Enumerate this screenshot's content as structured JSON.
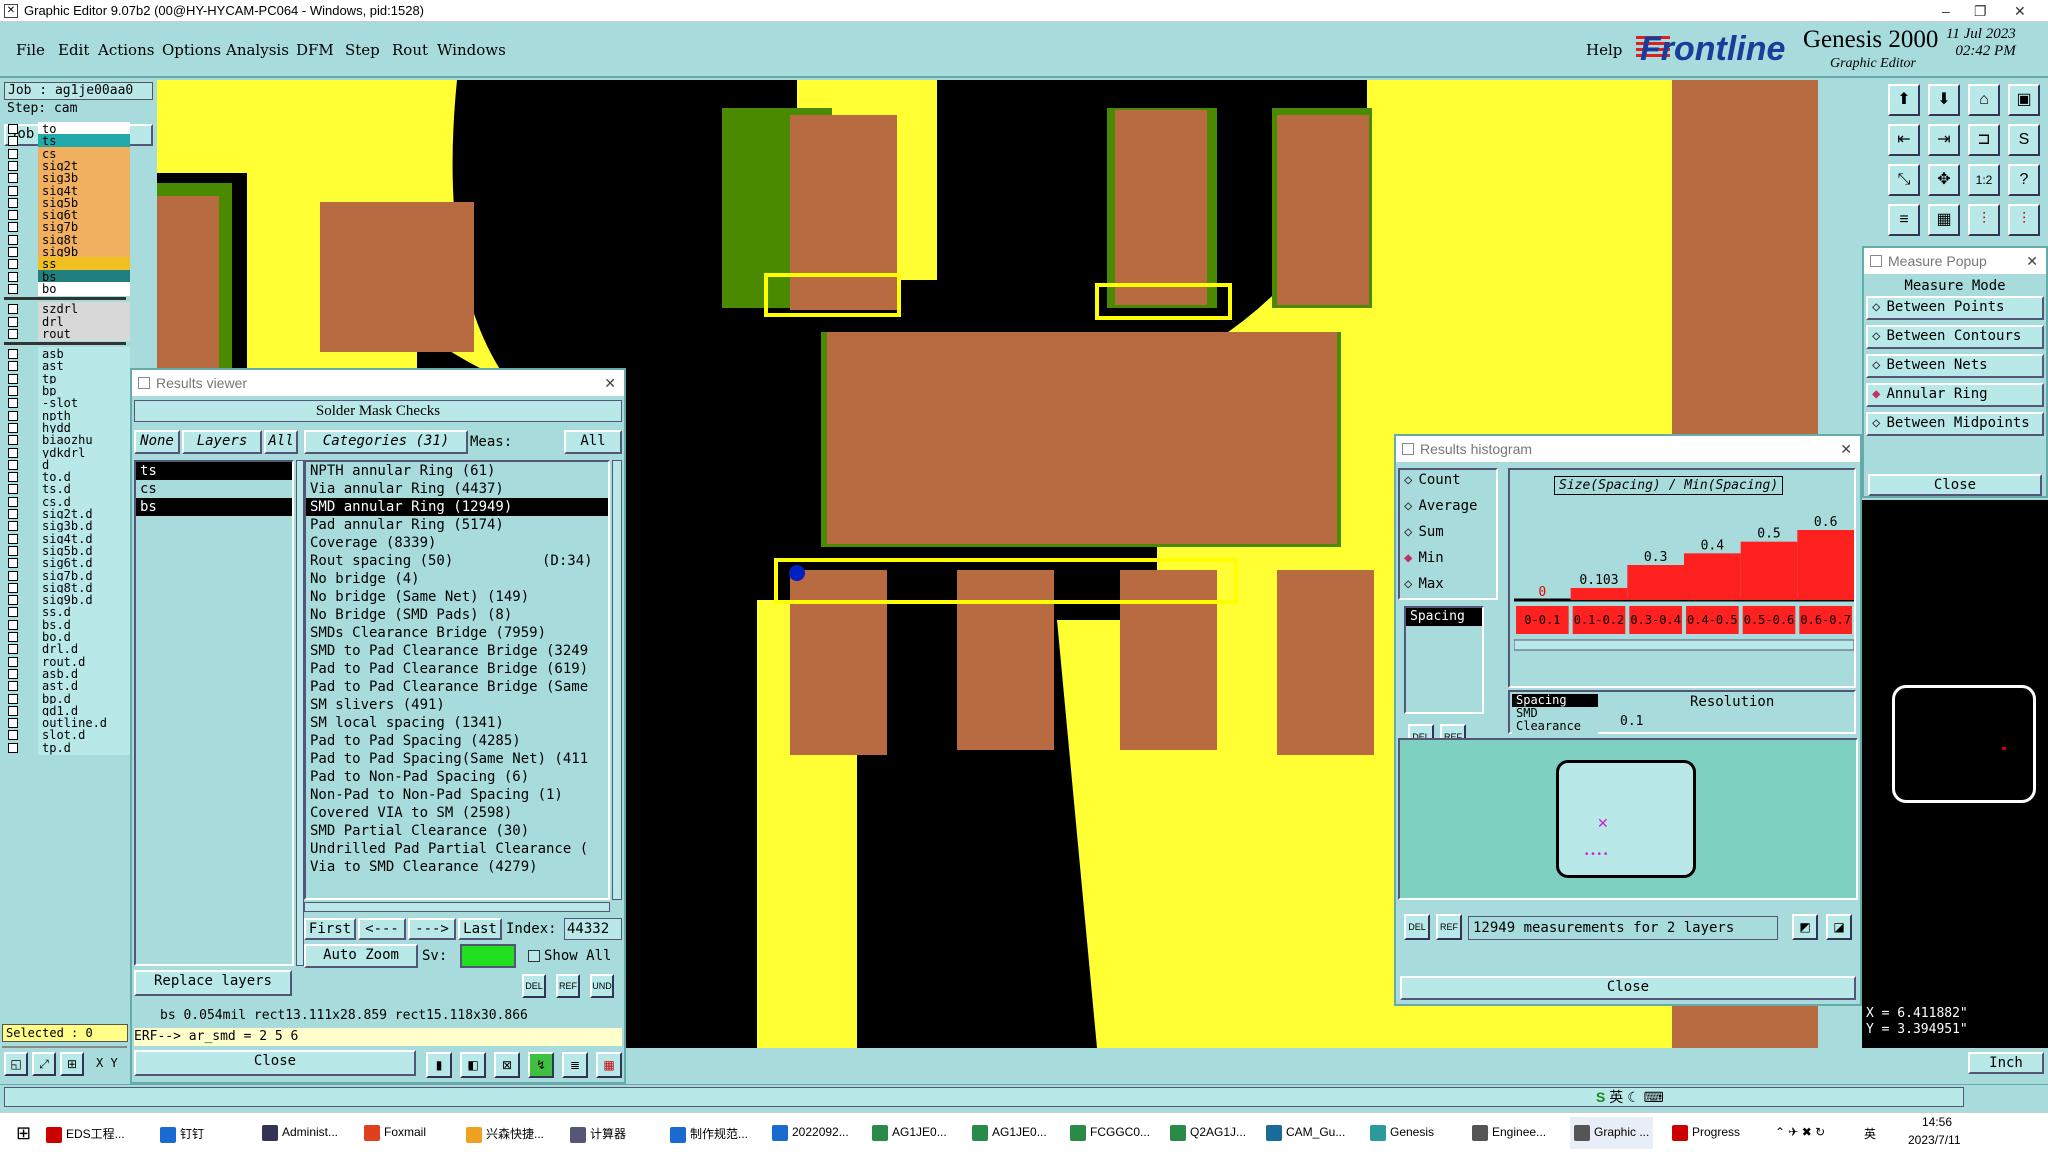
{
  "titlebar": {
    "title": "Graphic Editor 9.07b2 (00@HY-HYCAM-PC064 - Windows, pid:1528)"
  },
  "menu": {
    "items": [
      "File",
      "Edit",
      "Actions",
      "Options",
      "Analysis",
      "DFM",
      "Step",
      "Rout",
      "Windows"
    ],
    "help": "Help"
  },
  "brand": {
    "frontline": "Frontline",
    "genesis": "Genesis 2000",
    "subtitle": "Graphic Editor",
    "date": "11 Jul 2023",
    "time": "02:42 PM"
  },
  "job": {
    "job": "Job : ag1je00aa0",
    "step": "Step: cam",
    "matrix": "Job Matrix ..."
  },
  "layers_top": [
    "to",
    "ts",
    "cs",
    "sig2t",
    "sig3b",
    "sig4t",
    "sig5b",
    "sig6t",
    "sig7b",
    "sig8t",
    "sig9b",
    "ss",
    "bs",
    "bo"
  ],
  "layers_drill": [
    "szdrl",
    "drl",
    "rout"
  ],
  "layers_misc": [
    "asb",
    "ast",
    "tp",
    "bp",
    "-slot",
    "npth",
    "hydd",
    "biaozhu",
    "ydkdrl",
    "d",
    "to.d",
    "ts.d",
    "cs.d",
    "sig2t.d",
    "sig3b.d",
    "sig4t.d",
    "sig5b.d",
    "sig6t.d",
    "sig7b.d",
    "sig8t.d",
    "sig9b.d",
    "ss.d",
    "bs.d",
    "bo.d",
    "drl.d",
    "rout.d",
    "asb.d",
    "ast.d",
    "bp.d",
    "gd1.d",
    "outline.d",
    "slot.d",
    "tp.d"
  ],
  "selected": "Selected : 0",
  "results_viewer": {
    "title": "Results viewer",
    "header": "Solder Mask Checks",
    "none": "None",
    "layers": "Layers",
    "all": "All",
    "categories": "Categories (31)",
    "meas_label": "Meas:",
    "meas_value": "All",
    "layer_list": [
      "ts",
      "cs",
      "bs"
    ],
    "items": [
      "NPTH annular Ring (61)",
      "Via annular Ring (4437)",
      "SMD annular Ring (12949)",
      "Pad annular Ring (5174)",
      "Coverage (8339)",
      "Rout spacing (50)",
      "No bridge (4)",
      "No bridge (Same Net) (149)",
      "No Bridge (SMD Pads) (8)",
      "SMDs Clearance Bridge (7959)",
      "SMD to Pad Clearance Bridge (3249",
      "Pad to Pad Clearance Bridge (619)",
      "Pad to Pad Clearance Bridge (Same",
      "SM slivers (491)",
      "SM local spacing (1341)",
      "Pad to Pad Spacing (4285)",
      "Pad to Pad Spacing(Same Net) (411",
      "Pad to Non-Pad Spacing (6)",
      "Non-Pad to Non-Pad Spacing (1)",
      "Covered VIA to SM (2598)",
      "SMD Partial Clearance (30)",
      "Undrilled Pad Partial Clearance (",
      "Via to SMD Clearance (4279)"
    ],
    "rout_extra": "(D:34)",
    "first": "First",
    "prev": "<---",
    "next": "--->",
    "last": "Last",
    "index_label": "Index:",
    "index_value": "44332",
    "autozoom": "Auto Zoom",
    "sv": "Sv:",
    "showall": "Show All",
    "replace": "Replace layers",
    "info1": "bs 0.054mil  rect13.111x28.859  rect15.118x30.866",
    "info2": "ERF--> ar_smd = 2 5 6",
    "close": "Close"
  },
  "histogram": {
    "title": "Results histogram",
    "modes": [
      "Count",
      "Average",
      "Sum",
      "Min",
      "Max"
    ],
    "active_mode": "Min",
    "chart_title": "Size(Spacing) / Min(Spacing)",
    "list_item": "Spacing",
    "resolution_label": "Resolution",
    "resolution_value": "0.1",
    "types": [
      "Spacing",
      "SMD",
      "Clearance"
    ],
    "summary": "12949 measurements for 2 layers",
    "close": "Close"
  },
  "chart_data": {
    "type": "bar",
    "categories": [
      "0-0.1",
      "0.1-0.2",
      "0.3-0.4",
      "0.4-0.5",
      "0.5-0.6",
      "0.6-0.7"
    ],
    "labels": [
      "0",
      "0.103",
      "0.3",
      "0.4",
      "0.5",
      "0.6"
    ],
    "values": [
      0,
      0.103,
      0.3,
      0.4,
      0.5,
      0.6
    ],
    "color": "#ff2020",
    "title": "Size(Spacing) / Min(Spacing)"
  },
  "measure": {
    "title": "Measure Popup",
    "mode_label": "Measure Mode",
    "modes": [
      "Between Points",
      "Between Contours",
      "Between Nets",
      "Annular Ring",
      "Between Midpoints"
    ],
    "active": "Annular Ring",
    "close": "Close"
  },
  "coords": {
    "x": "X = 6.411882\"",
    "y": "Y = 3.394951\""
  },
  "units": "Inch",
  "xy_label": "X Y",
  "taskbar": {
    "apps": [
      "EDS工程...",
      "钉钉",
      "Administ...",
      "Foxmail",
      "兴森快捷...",
      "计算器",
      "制作规范...",
      "2022092...",
      "AG1JE0...",
      "AG1JE0...",
      "FCGGC0...",
      "Q2AG1J...",
      "CAM_Gu...",
      "Genesis",
      "Enginee...",
      "Graphic ...",
      "Progress"
    ],
    "time": "14:56",
    "date": "2023/7/11",
    "ime": "英"
  }
}
